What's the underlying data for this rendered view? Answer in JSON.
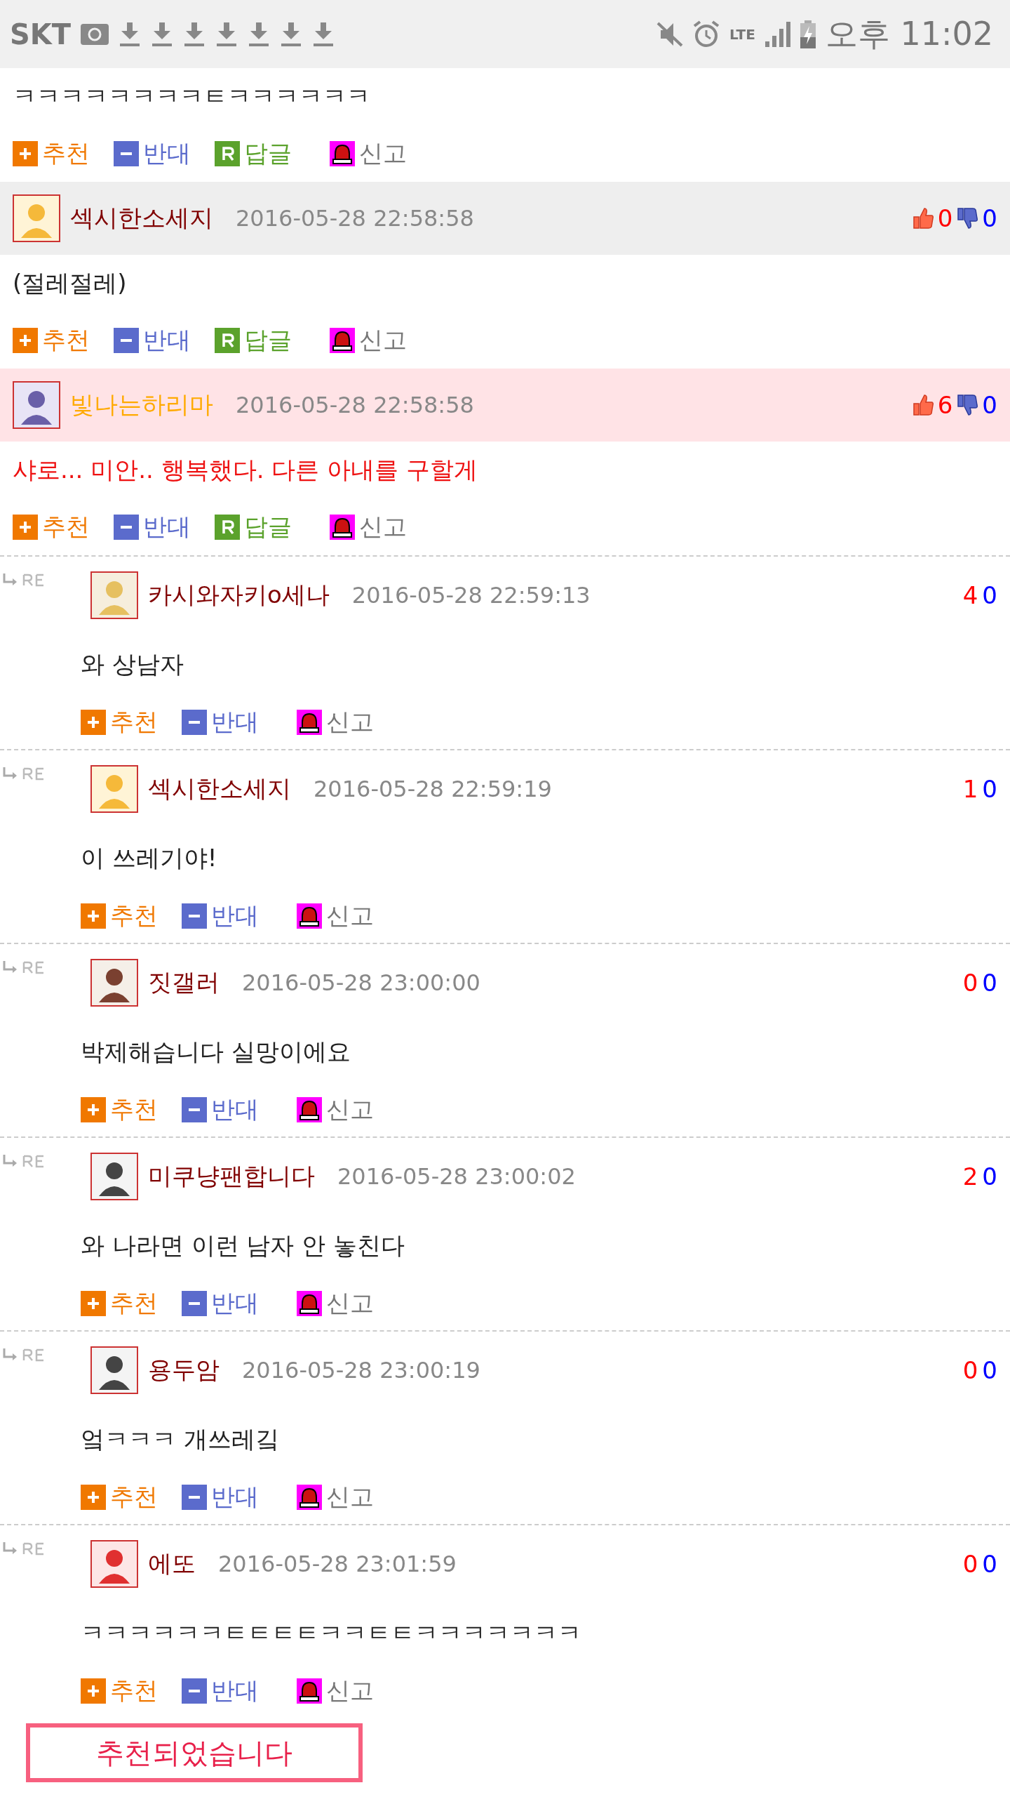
{
  "status_bar": {
    "carrier": "SKT",
    "network": "LTE",
    "time": "오후 11:02"
  },
  "top_comment": {
    "body": "ㅋㅋㅋㅋㅋㅋㅋㅋㅌㅋㅋㅋㅋㅋㅋ",
    "actions": [
      {
        "kind": "up",
        "label": "추천"
      },
      {
        "kind": "down",
        "label": "반대"
      },
      {
        "kind": "reply",
        "label": "답글"
      },
      {
        "kind": "report",
        "label": "신고"
      }
    ]
  },
  "comments": [
    {
      "kind": "comment",
      "best": false,
      "author": "섹시한소세지",
      "color": "#800000",
      "date": "2016-05-28 22:58:58",
      "likes": "0",
      "dislikes": "0",
      "body": "(절레절레)",
      "actions": [
        {
          "kind": "up",
          "label": "추천"
        },
        {
          "kind": "down",
          "label": "반대"
        },
        {
          "kind": "reply",
          "label": "답글"
        },
        {
          "kind": "report",
          "label": "신고"
        }
      ]
    },
    {
      "kind": "comment",
      "best": true,
      "author": "빛나는하리마",
      "color": "#ffaa00",
      "date": "2016-05-28 22:58:58",
      "likes": "6",
      "dislikes": "0",
      "body": "샤로... 미안.. 행복했다. 다른 아내를 구할게",
      "actions": [
        {
          "kind": "up",
          "label": "추천"
        },
        {
          "kind": "down",
          "label": "반대"
        },
        {
          "kind": "reply",
          "label": "답글"
        },
        {
          "kind": "report",
          "label": "신고"
        }
      ]
    },
    {
      "kind": "reply",
      "best": false,
      "author": "카시와자키o세나",
      "color": "#800000",
      "date": "2016-05-28 22:59:13",
      "likes": "4",
      "dislikes": "0",
      "body": "와 상남자",
      "actions": [
        {
          "kind": "up",
          "label": "추천"
        },
        {
          "kind": "down",
          "label": "반대"
        },
        {
          "kind": "report",
          "label": "신고"
        }
      ]
    },
    {
      "kind": "reply",
      "best": false,
      "author": "섹시한소세지",
      "color": "#800000",
      "date": "2016-05-28 22:59:19",
      "likes": "1",
      "dislikes": "0",
      "body": "이 쓰레기야!",
      "actions": [
        {
          "kind": "up",
          "label": "추천"
        },
        {
          "kind": "down",
          "label": "반대"
        },
        {
          "kind": "report",
          "label": "신고"
        }
      ]
    },
    {
      "kind": "reply",
      "best": false,
      "author": "짓갤러",
      "color": "#800000",
      "date": "2016-05-28 23:00:00",
      "likes": "0",
      "dislikes": "0",
      "body": "박제해습니다 실망이에요",
      "actions": [
        {
          "kind": "up",
          "label": "추천"
        },
        {
          "kind": "down",
          "label": "반대"
        },
        {
          "kind": "report",
          "label": "신고"
        }
      ]
    },
    {
      "kind": "reply",
      "best": false,
      "author": "미쿠냥팬합니다",
      "color": "#800000",
      "date": "2016-05-28 23:00:02",
      "likes": "2",
      "dislikes": "0",
      "body": "와 나라면 이런 남자 안 놓친다",
      "actions": [
        {
          "kind": "up",
          "label": "추천"
        },
        {
          "kind": "down",
          "label": "반대"
        },
        {
          "kind": "report",
          "label": "신고"
        }
      ]
    },
    {
      "kind": "reply",
      "best": false,
      "author": "용두암",
      "color": "#800000",
      "date": "2016-05-28 23:00:19",
      "likes": "0",
      "dislikes": "0",
      "body": "엌ㅋㅋㅋ 개쓰레깈",
      "actions": [
        {
          "kind": "up",
          "label": "추천"
        },
        {
          "kind": "down",
          "label": "반대"
        },
        {
          "kind": "report",
          "label": "신고"
        }
      ]
    },
    {
      "kind": "reply",
      "best": false,
      "author": "에또",
      "color": "#800000",
      "date": "2016-05-28 23:01:59",
      "likes": "0",
      "dislikes": "0",
      "body": "ㅋㅋㅋㅋㅋㅋㅌㅌㅌㅌㅋㅋㅌㅌㅋㅋㅋㅋㅋㅋㅋ",
      "actions": [
        {
          "kind": "up",
          "label": "추천"
        },
        {
          "kind": "down",
          "label": "반대"
        },
        {
          "kind": "report",
          "label": "신고"
        }
      ]
    }
  ],
  "recommend_notice": {
    "label": "추천되었습니다"
  }
}
